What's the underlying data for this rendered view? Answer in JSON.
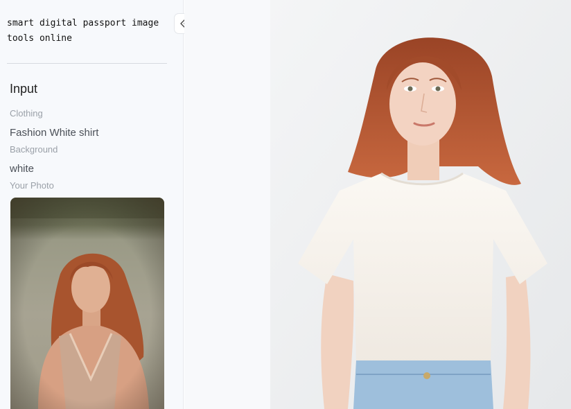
{
  "app": {
    "title": "smart digital passport image\ntools online"
  },
  "sidebar": {
    "section_title": "Input",
    "fields": [
      {
        "label": "Clothing",
        "value": "Fashion White shirt"
      },
      {
        "label": "Background",
        "value": "white"
      },
      {
        "label": "Your Photo"
      }
    ],
    "collapse_icon": "chevrons-left-icon"
  },
  "colors": {
    "sidebar_bg": "#f7f9fc",
    "result_bg": "#eef0f2",
    "hair": "#b85a35",
    "shirt": "#f6f2ec",
    "jeans": "#9ebfdc"
  }
}
